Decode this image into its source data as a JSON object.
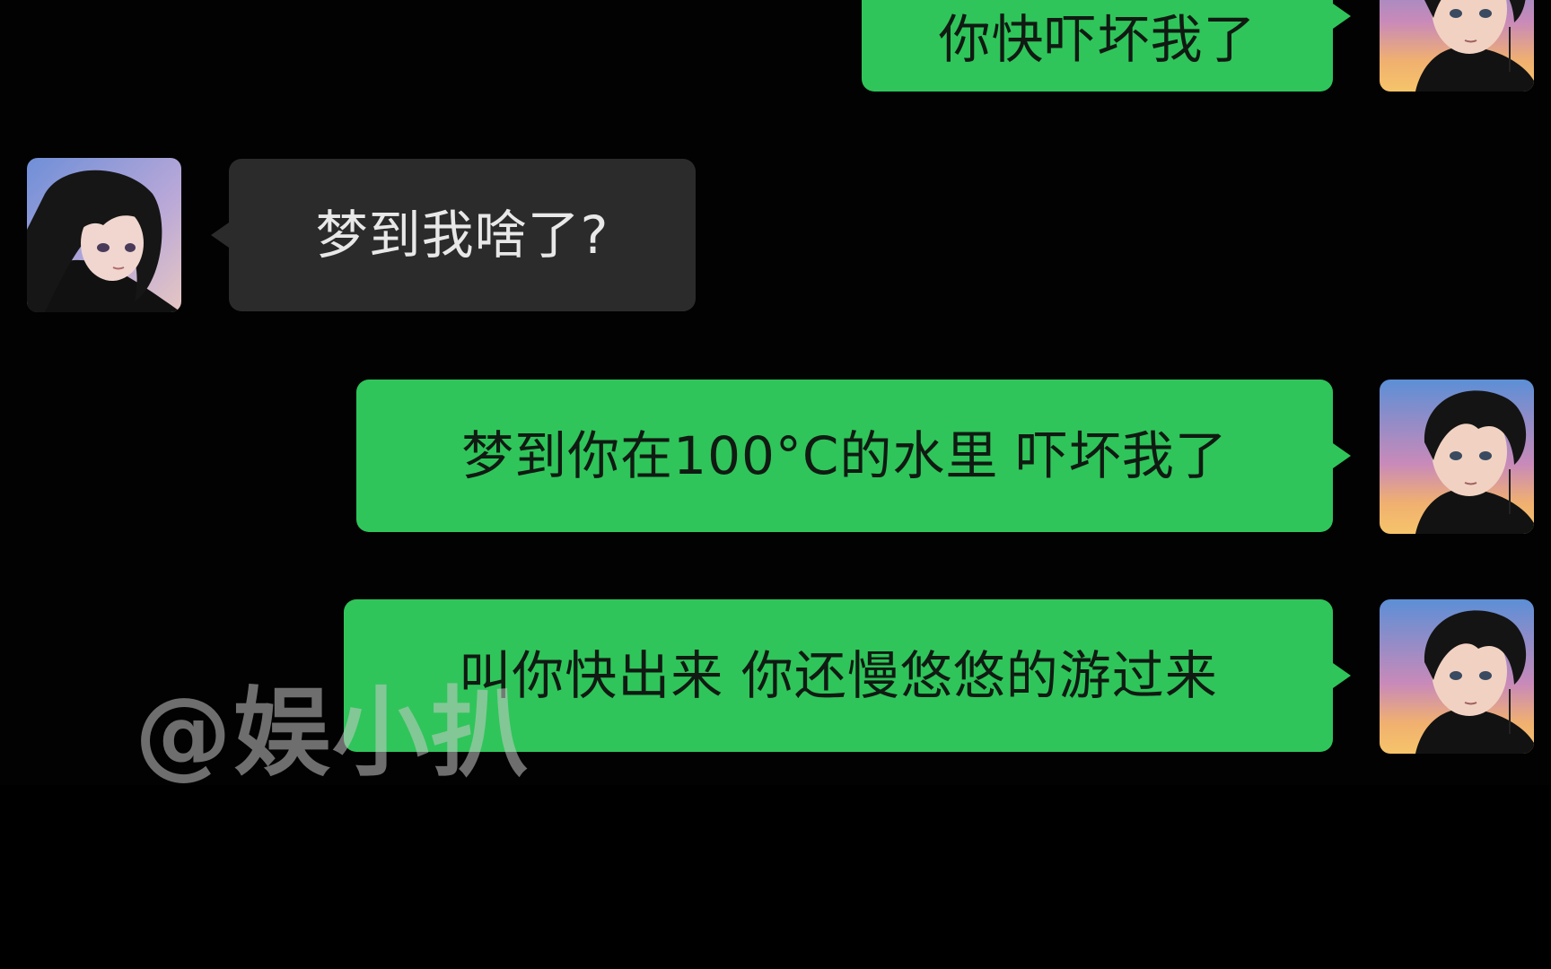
{
  "colors": {
    "background": "#000000",
    "my_bubble": "#2fc55a",
    "their_bubble": "#2b2b2b",
    "my_text": "#101a12",
    "their_text": "#e8e8e8"
  },
  "messages": [
    {
      "sender": "me",
      "text": "你快吓坏我了"
    },
    {
      "sender": "them",
      "text": "梦到我啥了?"
    },
    {
      "sender": "me",
      "text": "梦到你在100°C的水里 吓坏我了"
    },
    {
      "sender": "me",
      "text": "叫你快出来 你还慢悠悠的游过来"
    }
  ],
  "avatars": {
    "me": "boy-avatar-icon",
    "them": "girl-avatar-icon"
  },
  "watermark": "@娱小扒"
}
